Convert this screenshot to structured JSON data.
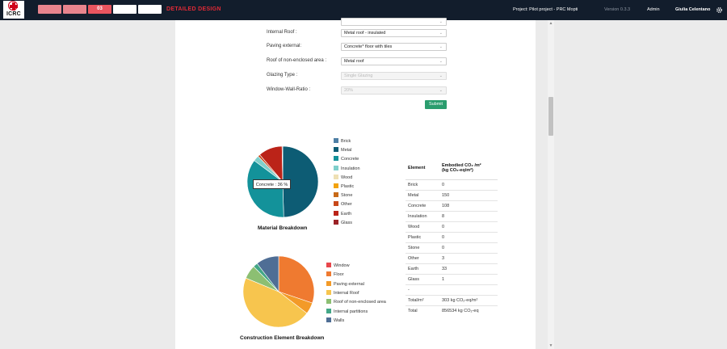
{
  "header": {
    "logo_text": "ICRC",
    "steps": [
      "",
      "",
      "03",
      "",
      ""
    ],
    "stage_title": "DETAILED DESIGN",
    "project": "Project: Pilot project - PRC Mopti",
    "version": "Version 0.3.3",
    "admin": "Admin",
    "user": "Giulia Celentano",
    "gear_icon": "gear-icon"
  },
  "form": {
    "fields": [
      {
        "label": "Internal Roof :",
        "value": "Metal roof - insulated",
        "disabled": false
      },
      {
        "label": "Paving external:",
        "value": "Concrete* floor with tiles",
        "disabled": false
      },
      {
        "label": "Roof of non-enclosed area :",
        "value": "Metal roof",
        "disabled": false
      },
      {
        "label": "Glazing Type :",
        "value": "Single Glazing",
        "disabled": true
      },
      {
        "label": "Window-Wall-Ratio :",
        "value": "20%",
        "disabled": true
      }
    ],
    "submit_label": "Submit"
  },
  "material_chart": {
    "title": "Material Breakdown",
    "tooltip": "Concrete : 36 %",
    "legend": [
      {
        "label": "Brick",
        "color": "#4e7fa5"
      },
      {
        "label": "Metal",
        "color": "#0d5c74"
      },
      {
        "label": "Concrete",
        "color": "#13929a"
      },
      {
        "label": "Insulation",
        "color": "#7fcfcb"
      },
      {
        "label": "Wood",
        "color": "#eee0b4"
      },
      {
        "label": "Plastic",
        "color": "#f2a30f"
      },
      {
        "label": "Stone",
        "color": "#c86a18"
      },
      {
        "label": "Other",
        "color": "#c8481a"
      },
      {
        "label": "Earth",
        "color": "#bb2318"
      },
      {
        "label": "Glass",
        "color": "#9b2226"
      }
    ]
  },
  "element_chart": {
    "title": "Construction Element Breakdown",
    "legend": [
      {
        "label": "Window",
        "color": "#e8474c"
      },
      {
        "label": "Floor",
        "color": "#ef7a30"
      },
      {
        "label": "Paving external",
        "color": "#f39a28"
      },
      {
        "label": "Internal Roof",
        "color": "#f7c54e"
      },
      {
        "label": "Roof of non-enclosed area",
        "color": "#8cbf72"
      },
      {
        "label": "Internal partitions",
        "color": "#43a787"
      },
      {
        "label": "Walls",
        "color": "#4f6e95"
      }
    ]
  },
  "table": {
    "header_element": "Element",
    "header_value_line1": "Embodied CO₂ /m²",
    "header_value_line2": "(kg CO₂-eq/m²)",
    "rows": [
      {
        "element": "Brick",
        "value": "0"
      },
      {
        "element": "Metal",
        "value": "150"
      },
      {
        "element": "Concrete",
        "value": "108"
      },
      {
        "element": "Insulation",
        "value": "8"
      },
      {
        "element": "Wood",
        "value": "0"
      },
      {
        "element": "Plastic",
        "value": "0"
      },
      {
        "element": "Stone",
        "value": "0"
      },
      {
        "element": "Other",
        "value": "3"
      },
      {
        "element": "Earth",
        "value": "33"
      },
      {
        "element": "Glass",
        "value": "1"
      },
      {
        "element": "-",
        "value": ""
      },
      {
        "element": "Total/m²",
        "value": "303 kg CO₂-eq/m²"
      },
      {
        "element": "Total",
        "value": "856534 kg CO₂-eq"
      }
    ]
  },
  "chart_data": [
    {
      "type": "pie",
      "title": "Material Breakdown",
      "categories": [
        "Brick",
        "Metal",
        "Concrete",
        "Insulation",
        "Wood",
        "Plastic",
        "Stone",
        "Other",
        "Earth",
        "Glass"
      ],
      "values": [
        0,
        49.5,
        35.6,
        2.6,
        0,
        0,
        0,
        1.0,
        10.9,
        0.3
      ]
    },
    {
      "type": "pie",
      "title": "Construction Element Breakdown",
      "categories": [
        "Window",
        "Floor",
        "Paving external",
        "Internal Roof",
        "Roof of non-enclosed area",
        "Internal partitions",
        "Walls"
      ],
      "values": [
        0,
        29,
        5,
        44,
        6,
        2,
        10
      ]
    }
  ]
}
